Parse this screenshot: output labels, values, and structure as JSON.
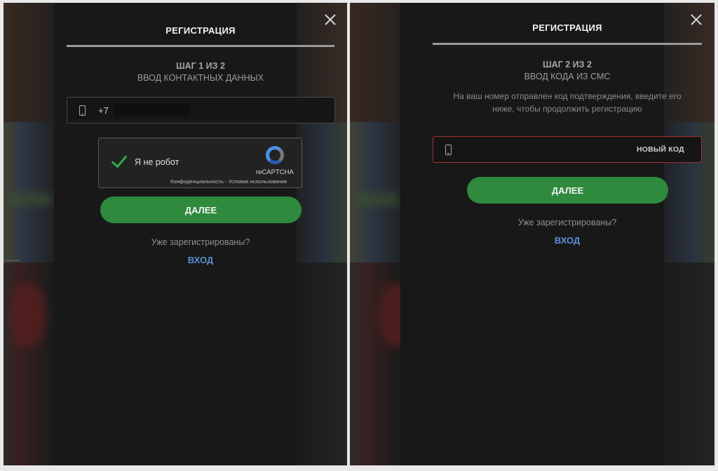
{
  "step1": {
    "title": "РЕГИСТРАЦИЯ",
    "step_label": "ШАГ 1 ИЗ 2",
    "step_desc": "ВВОД КОНТАКТНЫХ ДАННЫХ",
    "phone_prefix": "+7",
    "captcha": {
      "label": "Я не робот",
      "brand": "reCAPTCHA",
      "links": "Конфиденциальность - Условия использования"
    },
    "next_label": "ДАЛЕЕ",
    "already_registered": "Уже зарегистрированы?",
    "login_label": "ВХОД"
  },
  "step2": {
    "title": "РЕГИСТРАЦИЯ",
    "step_label": "ШАГ 2 ИЗ 2",
    "step_desc": "ВВОД КОДА ИЗ СМС",
    "info_line1": "На ваш номер отправлен код подтверждения, введите его",
    "info_line2": "ниже, чтобы продолжить регистрацию",
    "new_code_label": "НОВЫЙ КОД",
    "next_label": "ДАЛЕЕ",
    "already_registered": "Уже зарегистрированы?",
    "login_label": "ВХОД"
  },
  "colors": {
    "accent_green": "#2f8a3e",
    "link_blue": "#5a8fd6",
    "error_red": "#a13232",
    "check_green": "#2fa84f"
  },
  "icons": [
    "close-icon",
    "phone-icon",
    "check-icon",
    "recaptcha-logo-icon"
  ]
}
